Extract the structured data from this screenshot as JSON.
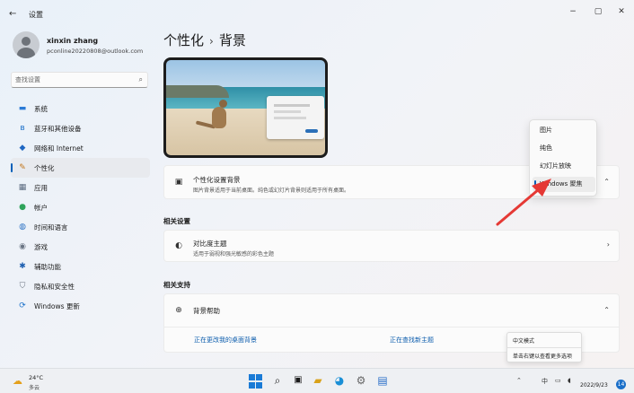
{
  "window": {
    "app_title": "设置",
    "back_icon": "←",
    "minimize_icon": "−",
    "maximize_icon": "▢",
    "close_icon": "✕"
  },
  "profile": {
    "name": "xinxin zhang",
    "email": "pconline20220808@outlook.com"
  },
  "search": {
    "placeholder": "查找设置",
    "icon": "⌕"
  },
  "sidebar": {
    "items": [
      {
        "label": "系统",
        "icon": "system-icon",
        "glyph": "▬",
        "color": "#2b7bd6"
      },
      {
        "label": "蓝牙和其他设备",
        "icon": "bluetooth-icon",
        "glyph": "ʙ",
        "color": "#1a6fc9"
      },
      {
        "label": "网络和 Internet",
        "icon": "wifi-icon",
        "glyph": "◆",
        "color": "#1f67c2"
      },
      {
        "label": "个性化",
        "icon": "brush-icon",
        "glyph": "✎",
        "color": "#c2761b"
      },
      {
        "label": "应用",
        "icon": "apps-icon",
        "glyph": "▦",
        "color": "#5b6b80"
      },
      {
        "label": "帐户",
        "icon": "account-icon",
        "glyph": "●",
        "color": "#2fa35a"
      },
      {
        "label": "时间和语言",
        "icon": "globe-icon",
        "glyph": "◍",
        "color": "#2c72c4"
      },
      {
        "label": "游戏",
        "icon": "gamepad-icon",
        "glyph": "◉",
        "color": "#6b7584"
      },
      {
        "label": "辅助功能",
        "icon": "accessibility-icon",
        "glyph": "✱",
        "color": "#1d5fb0"
      },
      {
        "label": "隐私和安全性",
        "icon": "shield-icon",
        "glyph": "⛉",
        "color": "#6a7280"
      },
      {
        "label": "Windows 更新",
        "icon": "update-icon",
        "glyph": "⟳",
        "color": "#1a6fc9"
      }
    ],
    "active_index": 3
  },
  "breadcrumb": {
    "parent": "个性化",
    "separator": "›",
    "current": "背景"
  },
  "background_card": {
    "title": "个性化设置背景",
    "description": "图片背景适用于当前桌面。纯色或幻灯片背景则适用于所有桌面。",
    "icon_glyph": "▣",
    "chevron": "⌃"
  },
  "dropdown": {
    "options": [
      "图片",
      "纯色",
      "幻灯片放映",
      "Windows 聚焦"
    ],
    "selected_index": 3
  },
  "related_settings": {
    "heading": "相关设置",
    "contrast": {
      "title": "对比度主题",
      "description": "适用于弱视和强光敏感的彩色主题",
      "icon_glyph": "◐",
      "chevron": "›"
    }
  },
  "related_support": {
    "heading": "相关支持",
    "help": {
      "title": "背景帮助",
      "icon_glyph": "⊕",
      "chevron": "⌃"
    },
    "links": [
      "正在更改我的桌面背景",
      "正在查找新主题"
    ]
  },
  "context_tooltip": {
    "line1": "中文模式",
    "line2": "单击右键以查看更多选项"
  },
  "taskbar": {
    "weather_temp": "24°C",
    "weather_condition": "多云",
    "weather_glyph": "☁",
    "ime_label": "中",
    "date": "2022/9/23",
    "notification_count": "14"
  },
  "colors": {
    "accent": "#005fb8",
    "link": "#0b5cad",
    "arrow": "#e53935"
  }
}
